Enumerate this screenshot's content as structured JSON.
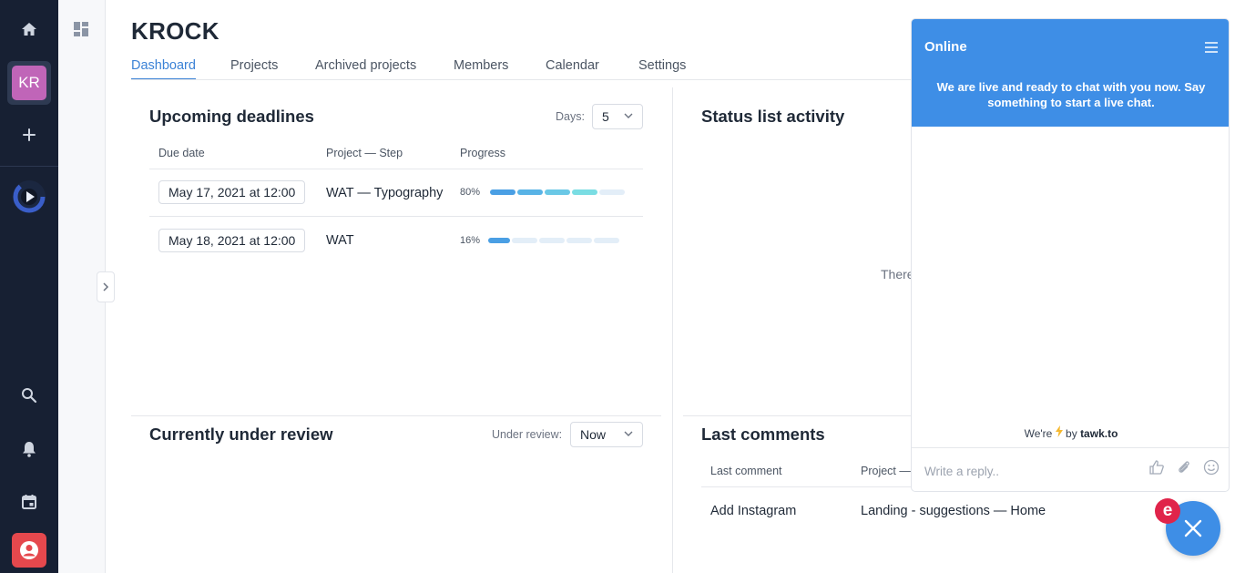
{
  "sidebar": {
    "avatar_initials": "KR",
    "items": [
      {
        "icon": "home-icon"
      },
      {
        "icon": "plus-icon"
      },
      {
        "icon": "search-icon"
      },
      {
        "icon": "bell-icon"
      },
      {
        "icon": "calendar-icon"
      },
      {
        "icon": "user-icon"
      }
    ]
  },
  "header": {
    "title": "KROCK",
    "tabs": [
      {
        "label": "Dashboard",
        "active": true
      },
      {
        "label": "Projects"
      },
      {
        "label": "Archived projects"
      },
      {
        "label": "Members"
      },
      {
        "label": "Calendar"
      },
      {
        "label": "Settings"
      }
    ]
  },
  "deadlines": {
    "title": "Upcoming deadlines",
    "days_label": "Days:",
    "days_value": "5",
    "columns": [
      "Due date",
      "Project — Step",
      "Progress"
    ],
    "rows": [
      {
        "due": "May 17, 2021 at 12:00",
        "project": "WAT — Typography",
        "progress_label": "80%",
        "progress": 0.8
      },
      {
        "due": "May 18, 2021 at 12:00",
        "project": "WAT",
        "progress_label": "16%",
        "progress": 0.16
      }
    ]
  },
  "status": {
    "title": "Status list activity",
    "partial_text": "There"
  },
  "review": {
    "title": "Currently under review",
    "label": "Under review:",
    "value": "Now"
  },
  "comments": {
    "title": "Last comments",
    "columns": [
      "Last comment",
      "Project —"
    ],
    "rows": [
      {
        "comment": "Add Instagram",
        "project": "Landing - suggestions — Home"
      }
    ]
  },
  "chat": {
    "status": "Online",
    "message": "We are live and ready to chat with you now. Say something to start a live chat.",
    "brand_prefix": "We're",
    "brand_by": "by",
    "brand_name": "tawk.to",
    "input_placeholder": "Write a reply..",
    "badge": "e"
  },
  "colors": {
    "sidebar_bg": "#172033",
    "accent": "#3b82d6",
    "chat_blue": "#3e8ee6",
    "avatar": "#c065b8",
    "danger": "#e5484d"
  }
}
